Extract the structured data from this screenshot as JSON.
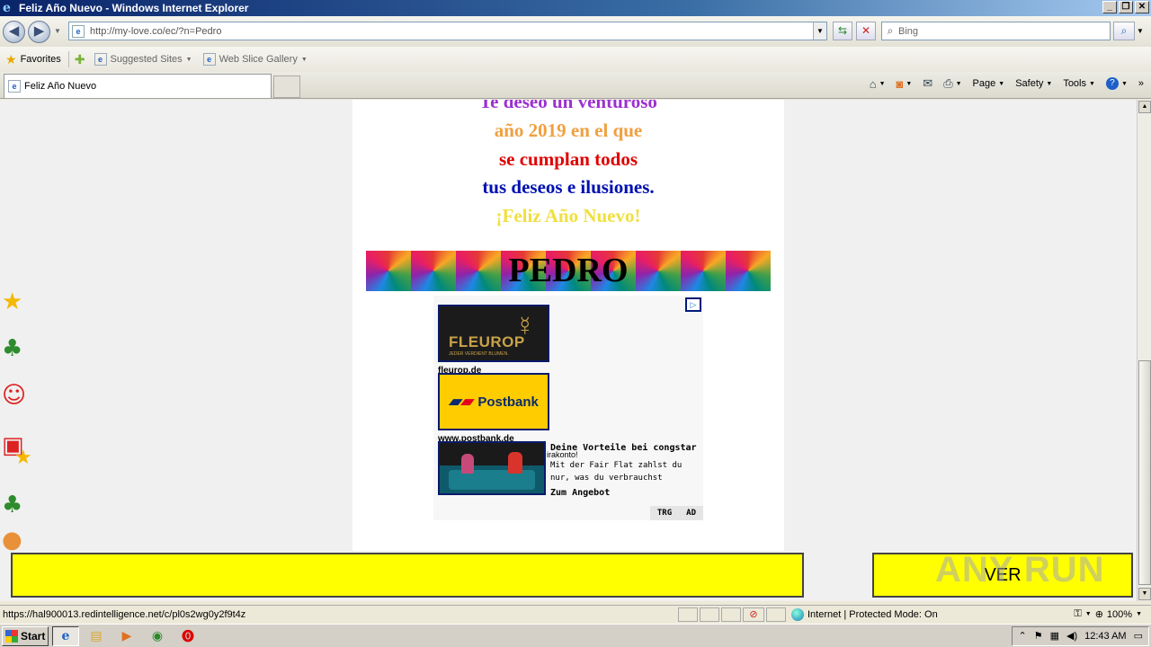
{
  "window": {
    "title": "Feliz Año Nuevo - Windows Internet Explorer"
  },
  "nav": {
    "url": "http://my-love.co/ec/?n=Pedro",
    "search_placeholder": "Bing"
  },
  "favorites": {
    "favorites_label": "Favorites",
    "suggested_label": "Suggested Sites",
    "gallery_label": "Web Slice Gallery"
  },
  "tab": {
    "label": "Feliz Año Nuevo"
  },
  "commands": {
    "page": "Page",
    "safety": "Safety",
    "tools": "Tools"
  },
  "page": {
    "lines": [
      {
        "text": "Te deseo un venturoso",
        "color": "#9b30d0"
      },
      {
        "text": "año 2019 en el que",
        "color": "#f0a040"
      },
      {
        "text": "se cumplan todos",
        "color": "#e00000"
      },
      {
        "text": "tus deseos e ilusiones.",
        "color": "#0010b0"
      },
      {
        "text": "¡Feliz Año Nuevo!",
        "color": "#f0e040"
      }
    ],
    "name": "PEDRO",
    "ver_button": "VER"
  },
  "ads": {
    "fleurop_brand": "FLEUROP",
    "fleurop_tag": "JEDER VERDIENT BLUMEN.",
    "fleurop_domain": "fleurop.de",
    "postbank_brand": "Postbank",
    "postbank_domain": "www.postbank.de",
    "overlap_text": "irakonto!",
    "congstar_title": "Deine Vorteile bei congstar",
    "congstar_sub": "Mit der Fair Flat zahlst du nur, was du verbrauchst",
    "congstar_cta": "Zum Angebot",
    "footer_trg": "TRG",
    "footer_ad": "AD"
  },
  "status": {
    "url": "https://hal900013.redintelligence.net/c/pl0s2wg0y2f9t4z",
    "zone": "Internet | Protected Mode: On",
    "zoom": "100%"
  },
  "taskbar": {
    "start": "Start",
    "clock": "12:43 AM"
  },
  "watermark": "ANY RUN"
}
